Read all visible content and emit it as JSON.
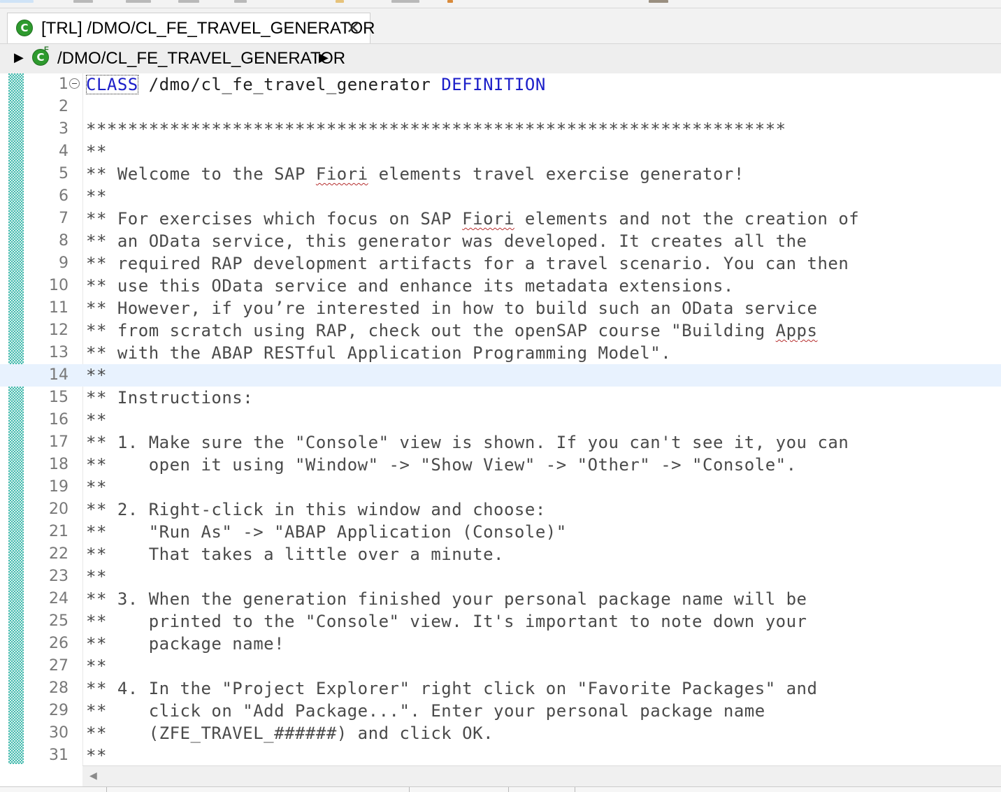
{
  "tab": {
    "icon": "abap-class-icon",
    "title": "[TRL] /DMO/CL_FE_TRAVEL_GENERATOR",
    "close_glyph": "✕"
  },
  "breadcrumb": {
    "label": "/DMO/CL_FE_TRAVEL_GENERATOR",
    "icon": "abap-class-icon"
  },
  "editor": {
    "current_line": 14,
    "lines": [
      {
        "n": "1",
        "t": ""
      },
      {
        "n": "2",
        "t": ""
      },
      {
        "n": "3",
        "t": "*******************************************************************"
      },
      {
        "n": "4",
        "t": "**"
      },
      {
        "n": "5",
        "t": "** Welcome to the SAP Fiori elements travel exercise generator!"
      },
      {
        "n": "6",
        "t": "**"
      },
      {
        "n": "7",
        "t": "** For exercises which focus on SAP Fiori elements and not the creation of"
      },
      {
        "n": "8",
        "t": "** an OData service, this generator was developed. It creates all the"
      },
      {
        "n": "9",
        "t": "** required RAP development artifacts for a travel scenario. You can then"
      },
      {
        "n": "10",
        "t": "** use this OData service and enhance its metadata extensions."
      },
      {
        "n": "11",
        "t": "** However, if you’re interested in how to build such an OData service"
      },
      {
        "n": "12",
        "t": "** from scratch using RAP, check out the openSAP course \"Building Apps"
      },
      {
        "n": "13",
        "t": "** with the ABAP RESTful Application Programming Model\"."
      },
      {
        "n": "14",
        "t": "**"
      },
      {
        "n": "15",
        "t": "** Instructions:"
      },
      {
        "n": "16",
        "t": "**"
      },
      {
        "n": "17",
        "t": "** 1. Make sure the \"Console\" view is shown. If you can't see it, you can"
      },
      {
        "n": "18",
        "t": "**    open it using \"Window\" -> \"Show View\" -> \"Other\" -> \"Console\"."
      },
      {
        "n": "19",
        "t": "**"
      },
      {
        "n": "20",
        "t": "** 2. Right-click in this window and choose:"
      },
      {
        "n": "21",
        "t": "**    \"Run As\" -> \"ABAP Application (Console)\""
      },
      {
        "n": "22",
        "t": "**    That takes a little over a minute."
      },
      {
        "n": "23",
        "t": "**"
      },
      {
        "n": "24",
        "t": "** 3. When the generation finished your personal package name will be"
      },
      {
        "n": "25",
        "t": "**    printed to the \"Console\" view. It's important to note down your"
      },
      {
        "n": "26",
        "t": "**    package name!"
      },
      {
        "n": "27",
        "t": "**"
      },
      {
        "n": "28",
        "t": "** 4. In the \"Project Explorer\" right click on \"Favorite Packages\" and"
      },
      {
        "n": "29",
        "t": "**    click on \"Add Package...\". Enter your personal package name"
      },
      {
        "n": "30",
        "t": "**    (ZFE_TRAVEL_######) and click OK."
      },
      {
        "n": "31",
        "t": "**"
      }
    ],
    "line1": {
      "kw_class": "CLASS",
      "class_name": " /dmo/cl_fe_travel_generator ",
      "kw_definition": "DEFINITION"
    },
    "spelling_flagged": {
      "fiori": "Fiori",
      "apps": "Apps"
    }
  },
  "scrollbar": {
    "left_arrow_glyph": "◀"
  },
  "colors": {
    "keyword": "#1b1ec9",
    "comment": "#4a4a4a",
    "line_number": "#787878",
    "current_line_bg": "#e8f2fe",
    "change_bar": "#43b8ad",
    "class_icon": "#2e9a2e"
  }
}
